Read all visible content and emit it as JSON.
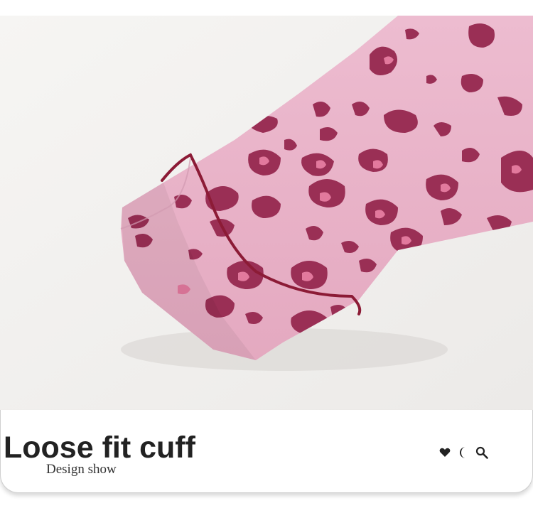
{
  "caption": {
    "title": "Loose fit cuff",
    "subtitle": "Design show"
  },
  "icons": [
    "heart-icon",
    "moon-icon",
    "search-icon"
  ],
  "colors": {
    "fabric": "#eab3c7",
    "spot_dark": "#9a2f55",
    "spot_light": "#e2799d",
    "piping": "#8c1b36",
    "backdrop": "#f3f1ef"
  }
}
